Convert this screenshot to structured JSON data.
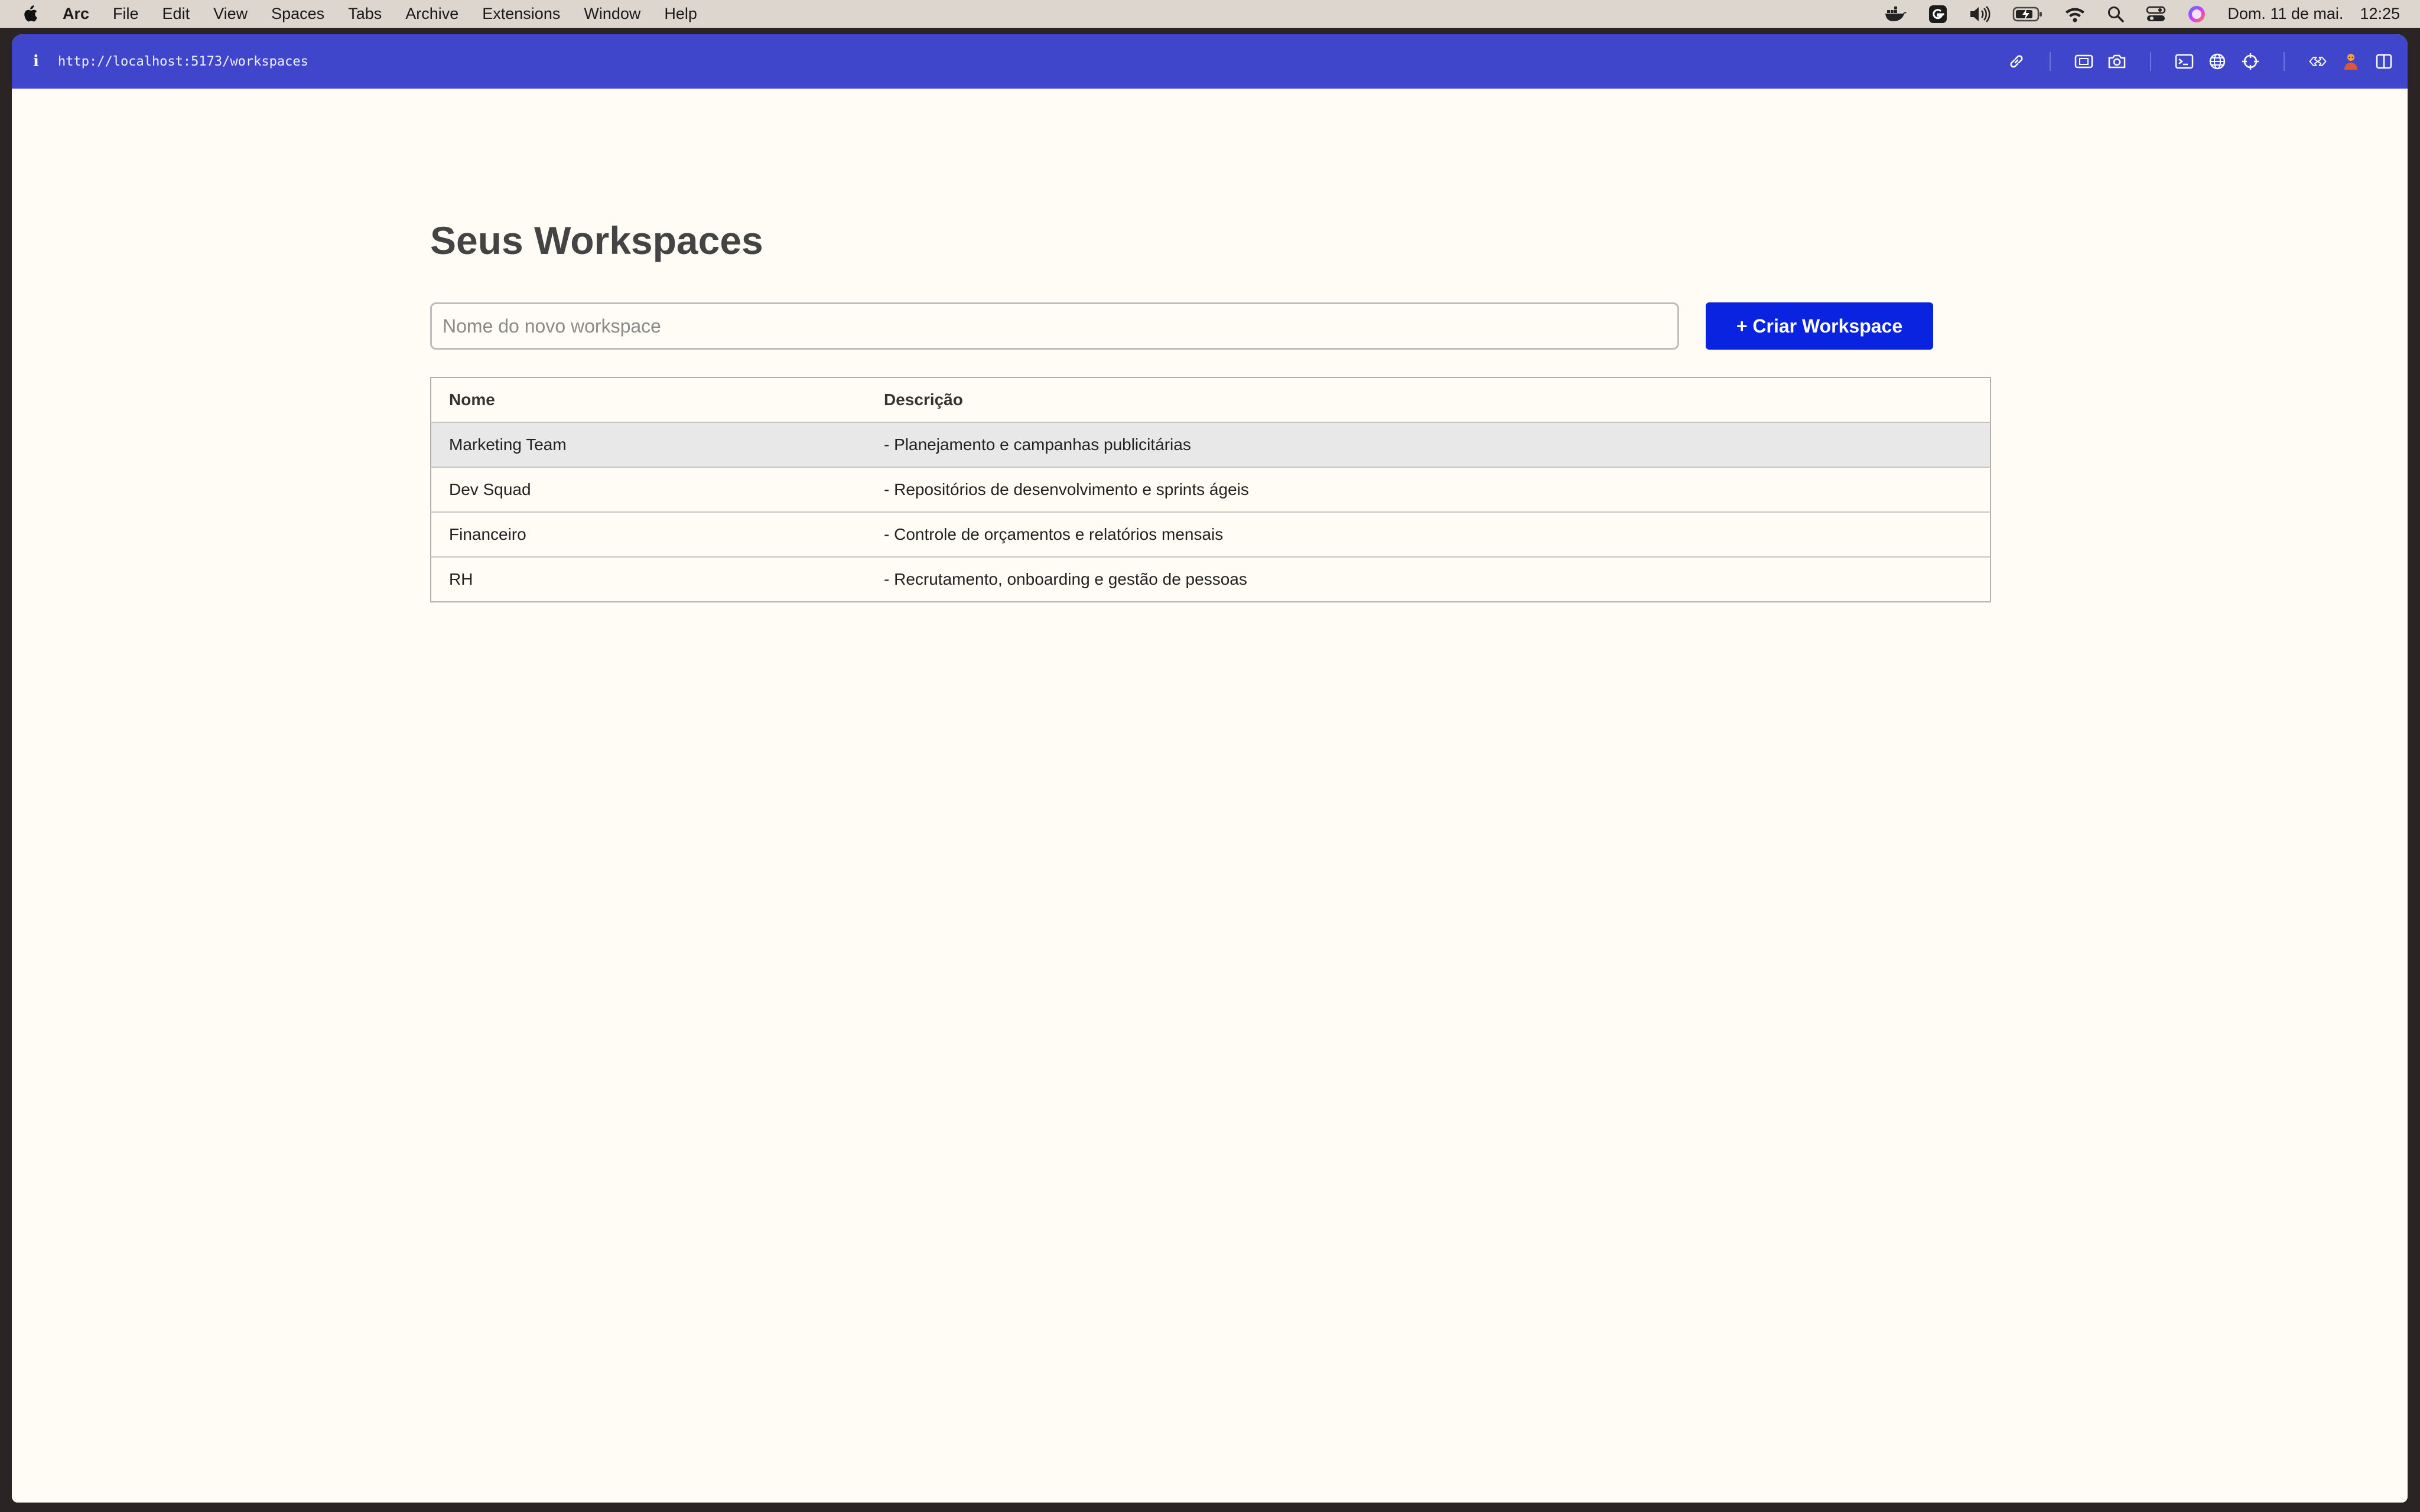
{
  "menubar": {
    "app_name": "Arc",
    "items": [
      "File",
      "Edit",
      "View",
      "Spaces",
      "Tabs",
      "Archive",
      "Extensions",
      "Window",
      "Help"
    ],
    "status_icons": [
      "docker-icon",
      "g-app-icon",
      "volume-icon",
      "battery-icon",
      "wifi-icon",
      "spotlight-search-icon",
      "control-center-icon",
      "siri-icon"
    ],
    "date": "Dom. 11 de mai.",
    "time": "12:25"
  },
  "browser": {
    "accent_color": "#4046cc",
    "url": "http://localhost:5173/workspaces",
    "info_label": "i",
    "toolbar_icons": [
      "link-icon",
      "capture-icon",
      "camera-icon",
      "terminal-icon",
      "globe-icon",
      "crosshair-icon",
      "extensions-icon",
      "avatar-icon",
      "sidebar-toggle-icon"
    ]
  },
  "page": {
    "title": "Seus Workspaces",
    "new_workspace": {
      "placeholder": "Nome do novo workspace",
      "value": ""
    },
    "create_button_label": "+ Criar Workspace",
    "create_button_color": "#0a23e0",
    "table": {
      "headers": [
        "Nome",
        "Descrição"
      ],
      "rows": [
        {
          "name": "Marketing Team",
          "description": "- Planejamento e campanhas publicitárias"
        },
        {
          "name": "Dev Squad",
          "description": "- Repositórios de desenvolvimento e sprints ágeis"
        },
        {
          "name": "Financeiro",
          "description": "- Controle de orçamentos e relatórios mensais"
        },
        {
          "name": "RH",
          "description": "- Recrutamento, onboarding e gestão de pessoas"
        }
      ]
    }
  }
}
